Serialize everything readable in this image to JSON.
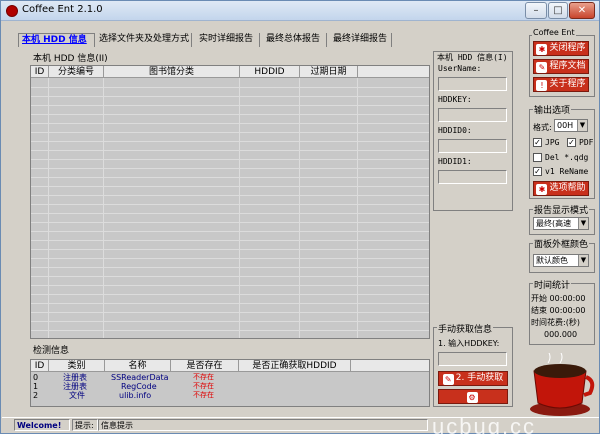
{
  "window": {
    "title": "Coffee Ent 2.1.0",
    "min": "–",
    "max": "□",
    "close": "✕"
  },
  "tabs": [
    "本机 HDD 信息",
    "选择文件夹及处理方式",
    "实时详细报告",
    "最终总体报告",
    "最终详细报告"
  ],
  "hdd_info": {
    "label": "本机 HDD 信息(II)",
    "columns": [
      "ID",
      "分类编号",
      "图书馆分类",
      "HDDID",
      "过期日期"
    ]
  },
  "check_info": {
    "label": "检测信息",
    "columns": [
      "ID",
      "类别",
      "名称",
      "是否存在",
      "是否正确获取HDDID"
    ],
    "rows": [
      {
        "id": "0",
        "type": "注册表",
        "name": "SSReaderData",
        "exists": "不存在"
      },
      {
        "id": "1",
        "type": "注册表",
        "name": "RegCode",
        "exists": "不存在"
      },
      {
        "id": "2",
        "type": "文件",
        "name": "ulib.info",
        "exists": "不存在"
      }
    ]
  },
  "hdd_side": {
    "label": "本机 HDD 信息(I)",
    "fields": [
      "UserName:",
      "HDDKEY:",
      "HDDID0:",
      "HDDID1:"
    ]
  },
  "manual": {
    "label": "手动获取信息",
    "input_label": "1. 输入HDDKEY:",
    "button": "2. 手动获取"
  },
  "coffee_ent": {
    "label": "Coffee Ent",
    "buttons": [
      "关闭程序",
      "程序文档",
      "关于程序"
    ]
  },
  "output": {
    "label": "输出选项",
    "format_label": "格式:",
    "format_value": "00H",
    "jpg": "JPG",
    "pdf": "PDF",
    "del": "Del *.qdg",
    "rename": "v1 ReName",
    "help_button": "选项帮助"
  },
  "report_mode": {
    "label": "报告显示模式",
    "value": "最终(高速"
  },
  "panel_color": {
    "label": "面板外框颜色",
    "value": "默认颜色"
  },
  "timing": {
    "label": "时间统计",
    "start": "开始 00:00:00",
    "end": "结束 00:00:00",
    "cost_label": "时间花费:(秒)",
    "cost_value": "000.000"
  },
  "status": [
    "Welcome!",
    "提示:",
    "信息提示"
  ],
  "watermark": "ucbug.cc"
}
